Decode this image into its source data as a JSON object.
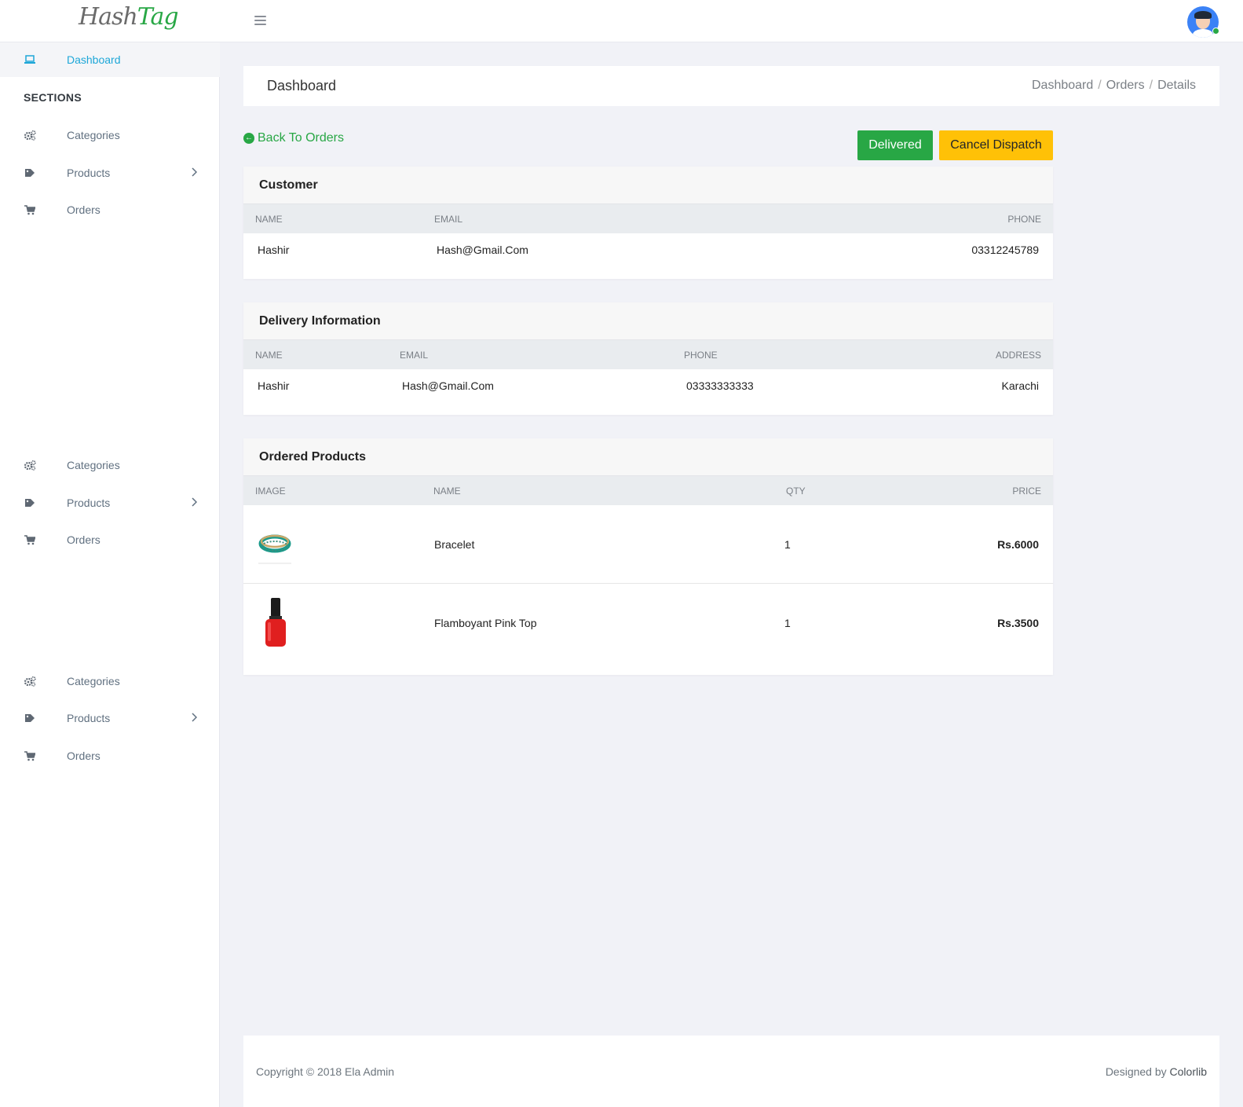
{
  "header": {
    "logo_hash": "Hash",
    "logo_tag": "Tag"
  },
  "sidebar": {
    "dashboard_label": "Dashboard",
    "sections_title": "SECTIONS",
    "groups": [
      {
        "categories": "Categories",
        "products": "Products",
        "orders": "Orders"
      },
      {
        "categories": "Categories",
        "products": "Products",
        "orders": "Orders"
      },
      {
        "categories": "Categories",
        "products": "Products",
        "orders": "Orders"
      }
    ]
  },
  "page": {
    "title": "Dashboard",
    "breadcrumb": [
      "Dashboard",
      "Orders",
      "Details"
    ],
    "back_link": "Back To Orders",
    "btn_delivered": "Delivered",
    "btn_cancel": "Cancel Dispatch"
  },
  "customer": {
    "title": "Customer",
    "headers": [
      "NAME",
      "EMAIL",
      "PHONE"
    ],
    "row": {
      "name": "Hashir",
      "email": "Hash@Gmail.Com",
      "phone": "03312245789"
    }
  },
  "delivery": {
    "title": "Delivery Information",
    "headers": [
      "NAME",
      "EMAIL",
      "PHONE",
      "ADDRESS"
    ],
    "row": {
      "name": "Hashir",
      "email": "Hash@Gmail.Com",
      "phone": "03333333333",
      "address": "Karachi"
    }
  },
  "products": {
    "title": "Ordered Products",
    "headers": [
      "IMAGE",
      "NAME",
      "QTY",
      "PRICE"
    ],
    "rows": [
      {
        "name": "Bracelet",
        "qty": "1",
        "price": "Rs.6000"
      },
      {
        "name": "Flamboyant Pink Top",
        "qty": "1",
        "price": "Rs.3500"
      }
    ]
  },
  "footer": {
    "copyright": "Copyright © 2018 Ela Admin",
    "designed_by": "Designed by ",
    "designer": "Colorlib"
  },
  "colors": {
    "accent_green": "#28a745",
    "accent_yellow": "#ffc107",
    "active_blue": "#1ea7d8"
  }
}
